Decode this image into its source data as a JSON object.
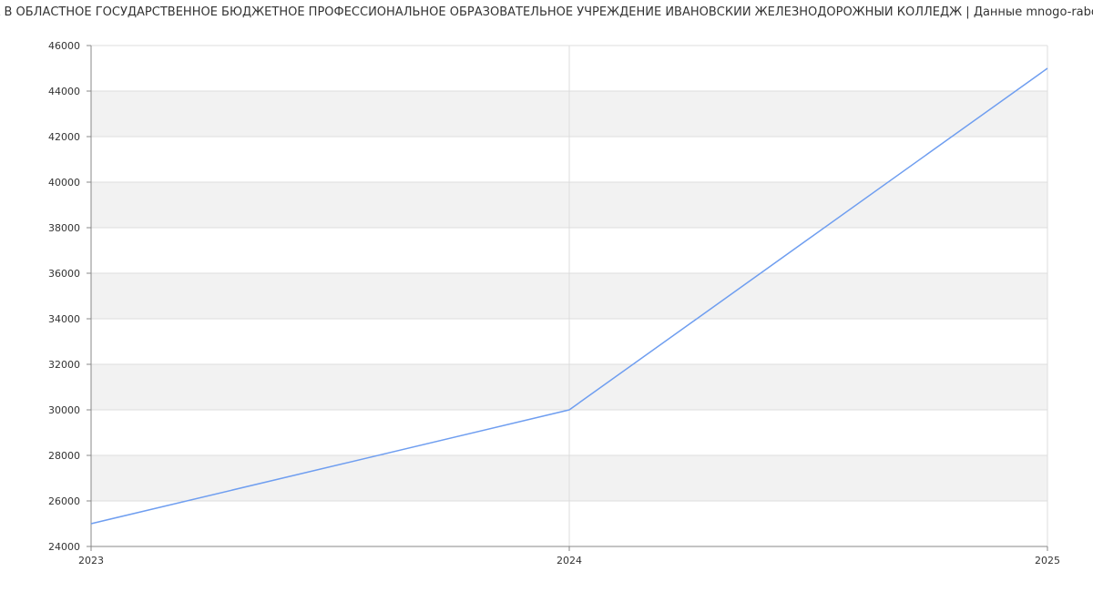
{
  "chart_data": {
    "type": "line",
    "title": "ЗАРПЛАТА В ОБЛАСТНОЕ ГОСУДАРСТВЕННОЕ БЮДЖЕТНОЕ ПРОФЕССИОНАЛЬНОЕ ОБРАЗОВАТЕЛЬНОЕ УЧРЕЖДЕНИЕ ИВАНОВСКИЙ ЖЕЛЕЗНОДОРОЖНЫЙ КОЛЛЕДЖ | Данные mnogo-rabot.ru",
    "xlabel": "",
    "ylabel": "",
    "x": [
      "2023",
      "2024",
      "2025"
    ],
    "series": [
      {
        "values": [
          25000,
          30000,
          45000
        ]
      }
    ],
    "ylim": [
      24000,
      46000
    ],
    "yticks": [
      24000,
      26000,
      28000,
      30000,
      32000,
      34000,
      36000,
      38000,
      40000,
      42000,
      44000,
      46000
    ],
    "grid": true,
    "legend": "none",
    "colors": {
      "line": "#6f9ef0",
      "band": "#f2f2f2",
      "grid": "#dddddd",
      "axis": "#888888",
      "text": "#333333"
    }
  }
}
